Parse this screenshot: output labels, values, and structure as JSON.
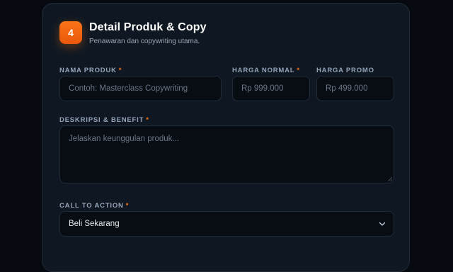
{
  "section": {
    "step_number": "4",
    "title": "Detail Produk & Copy",
    "subtitle": "Penawaran dan copywriting utama."
  },
  "fields": {
    "product_name": {
      "label": "NAMA PRODUK",
      "required_mark": "*",
      "placeholder": "Contoh: Masterclass Copywriting",
      "value": ""
    },
    "normal_price": {
      "label": "HARGA NORMAL",
      "required_mark": "*",
      "placeholder": "Rp 999.000",
      "value": ""
    },
    "promo_price": {
      "label": "HARGA PROMO",
      "placeholder": "Rp 499.000",
      "value": ""
    },
    "description": {
      "label": "DESKRIPSI & BENEFIT",
      "required_mark": "*",
      "placeholder": "Jelaskan keunggulan produk...",
      "value": ""
    },
    "cta": {
      "label": "CALL TO ACTION",
      "required_mark": "*",
      "selected": "Beli Sekarang"
    }
  },
  "icons": {
    "dropdown": "chevron-down-icon"
  },
  "colors": {
    "accent": "#f97316",
    "card_bg": "#0f1822",
    "input_bg": "#080d14",
    "border": "#1f2b38"
  }
}
